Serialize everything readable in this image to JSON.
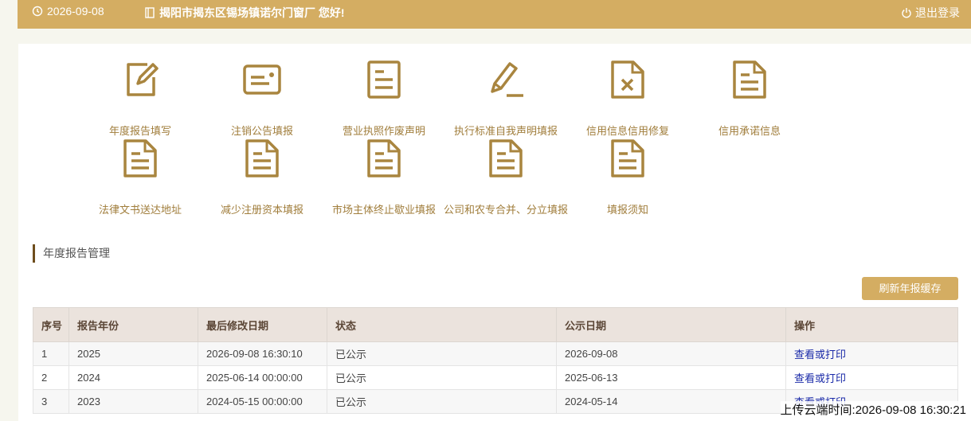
{
  "topbar": {
    "date": "2026-09-08",
    "welcome": "揭阳市揭东区锡场镇诺尔门窗厂 您好!",
    "logout": "退出登录"
  },
  "menu": [
    {
      "label": "年度报告填写",
      "icon": "edit-document-icon"
    },
    {
      "label": "注销公告填报",
      "icon": "card-icon"
    },
    {
      "label": "营业执照作废声明",
      "icon": "document-icon"
    },
    {
      "label": "执行标准自我声明填报",
      "icon": "pencil-icon"
    },
    {
      "label": "信用信息信用修复",
      "icon": "document-x-icon"
    },
    {
      "label": "信用承诺信息",
      "icon": "document-icon"
    },
    {
      "label": "法律文书送达地址",
      "icon": "document-icon"
    },
    {
      "label": "减少注册资本填报",
      "icon": "document-icon"
    },
    {
      "label": "市场主体终止歇业填报",
      "icon": "document-icon"
    },
    {
      "label": "公司和农专合并、分立填报",
      "icon": "document-icon"
    },
    {
      "label": "填报须知",
      "icon": "document-icon"
    }
  ],
  "section": {
    "title": "年度报告管理",
    "refresh_button": "刷新年报缓存"
  },
  "table": {
    "headers": [
      "序号",
      "报告年份",
      "最后修改日期",
      "状态",
      "公示日期",
      "操作"
    ],
    "rows": [
      [
        "1",
        "2025",
        "2026-09-08 16:30:10",
        "已公示",
        "2026-09-08",
        "查看或打印"
      ],
      [
        "2",
        "2024",
        "2025-06-14 00:00:00",
        "已公示",
        "2025-06-13",
        "查看或打印"
      ],
      [
        "3",
        "2023",
        "2024-05-15 00:00:00",
        "已公示",
        "2024-05-14",
        "查看或打印"
      ]
    ]
  },
  "footer": {
    "upload_time": "上传云端时间:2026-09-08 16:30:21"
  },
  "colors": {
    "accent": "#d4ad62",
    "icon": "#a9853f",
    "link": "#1a2aa8"
  }
}
